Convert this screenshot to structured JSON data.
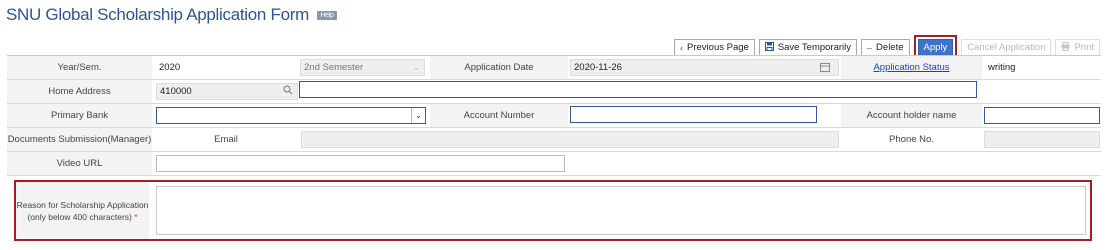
{
  "page": {
    "title": "SNU Global Scholarship Application Form",
    "help_label": "Help"
  },
  "toolbar": {
    "previous_page": "Previous Page",
    "save_temporarily": "Save Temporarily",
    "delete": "Delete",
    "apply": "Apply",
    "cancel_application": "Cancel Application",
    "print": "Print"
  },
  "form": {
    "year_sem_label": "Year/Sem.",
    "year_value": "2020",
    "semester_value": "2nd Semester",
    "application_date_label": "Application Date",
    "application_date_value": "2020-11-26",
    "application_status_label": "Application Status",
    "application_status_value": "writing",
    "home_address_label": "Home Address",
    "postal_code_value": "410000",
    "address_value": "",
    "primary_bank_label": "Primary Bank",
    "primary_bank_value": "",
    "account_number_label": "Account Number",
    "account_number_value": "",
    "account_holder_label": "Account holder name",
    "account_holder_value": "",
    "documents_label": "Documents Submission(Manager)",
    "email_label": "Email",
    "phone_label": "Phone No.",
    "video_url_label": "Video URL",
    "video_url_value": "",
    "reason_label_line1": "Reason for Scholarship Application",
    "reason_label_line2": "(only below 400 characters)",
    "required_mark": "*"
  }
}
